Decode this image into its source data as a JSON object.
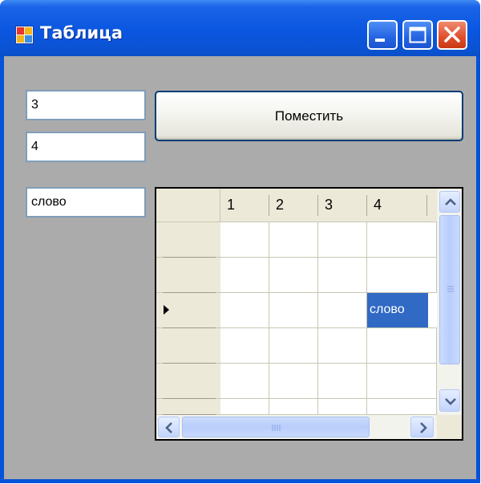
{
  "window": {
    "title": "Таблица",
    "title_color": "#ffffff",
    "titlebar_color": "#0a56e0",
    "client_background": "#ababab"
  },
  "caption_buttons": [
    "minimize-icon",
    "maximize-icon",
    "close-icon"
  ],
  "fields": {
    "rows_value": "3",
    "cols_value": "4",
    "word_value": "слово"
  },
  "place_button": {
    "label": "Поместить"
  },
  "grid": {
    "column_headers": [
      "1",
      "2",
      "3",
      "4"
    ],
    "current_row_index": 2,
    "cells": [
      [
        "",
        "",
        "",
        ""
      ],
      [
        "",
        "",
        "",
        ""
      ],
      [
        "",
        "",
        "",
        "слово"
      ],
      [
        "",
        "",
        "",
        ""
      ],
      [
        "",
        "",
        "",
        ""
      ],
      [
        "",
        "",
        "",
        ""
      ]
    ],
    "selected_cell": {
      "row": 2,
      "col": 3
    },
    "selection_color": "#316ac5"
  }
}
